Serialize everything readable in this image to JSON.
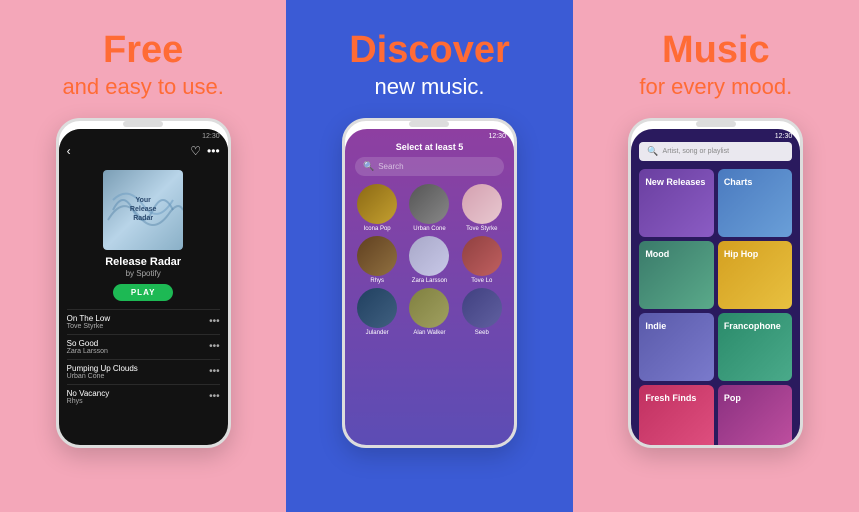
{
  "panels": {
    "left": {
      "title": "Free",
      "subtitle": "and easy to use.",
      "phone": {
        "time": "12:30",
        "album_title": "Release Radar",
        "album_by": "by Spotify",
        "play_label": "PLAY",
        "album_art_text": "Your\nRelease\nRadar",
        "tracks": [
          {
            "name": "On The Low",
            "artist": "Tove Styrke"
          },
          {
            "name": "So Good",
            "artist": "Zara Larsson"
          },
          {
            "name": "Pumping Up Clouds",
            "artist": "Urban Cone"
          },
          {
            "name": "No Vacancy",
            "artist": "Rhys"
          }
        ]
      }
    },
    "center": {
      "title": "Discover",
      "subtitle": "new music.",
      "phone": {
        "time": "12:30",
        "select_prompt": "Select at least 5",
        "search_placeholder": "Search",
        "artists": [
          {
            "name": "Icona Pop"
          },
          {
            "name": "Urban Cone"
          },
          {
            "name": "Tove Styrke"
          },
          {
            "name": "Rhys"
          },
          {
            "name": "Zara Larsson"
          },
          {
            "name": "Tove Lo"
          },
          {
            "name": "Julander"
          },
          {
            "name": "Alan Walker"
          },
          {
            "name": "Seeb"
          }
        ]
      }
    },
    "right": {
      "title": "Music",
      "subtitle": "for every mood.",
      "phone": {
        "time": "12:30",
        "search_placeholder": "Artist, song or playlist",
        "categories": [
          {
            "label": "New Releases",
            "class": "cat-new-releases"
          },
          {
            "label": "Charts",
            "class": "cat-charts"
          },
          {
            "label": "Mood",
            "class": "cat-mood"
          },
          {
            "label": "Hip Hop",
            "class": "cat-hip-hop"
          },
          {
            "label": "Indie",
            "class": "cat-indie"
          },
          {
            "label": "Francophone",
            "class": "cat-francophone"
          },
          {
            "label": "Fresh Finds",
            "class": "cat-fresh-finds"
          },
          {
            "label": "Pop",
            "class": "cat-pop"
          }
        ]
      }
    }
  }
}
